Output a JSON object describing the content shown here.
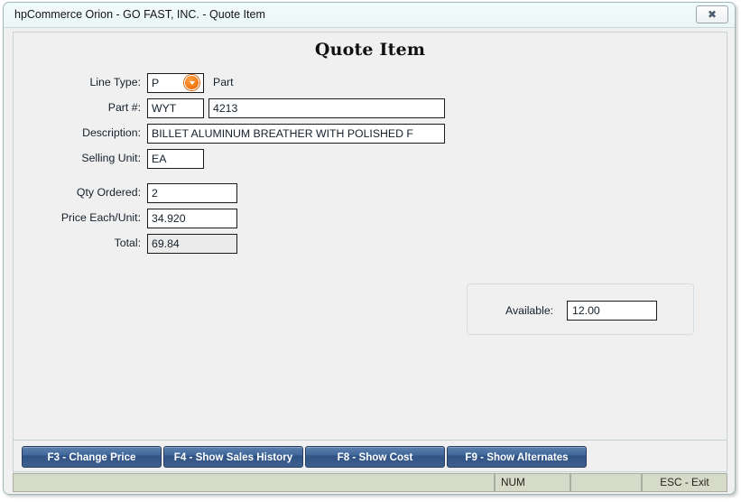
{
  "window": {
    "title": "hpCommerce Orion - GO FAST, INC. - Quote Item",
    "close_glyph": "✖"
  },
  "page": {
    "title": "Quote Item"
  },
  "form": {
    "line_type": {
      "label": "Line Type:",
      "value": "P",
      "suffix_text": "Part"
    },
    "part_number": {
      "label": "Part #:",
      "prefix_value": "WYT",
      "value": "4213"
    },
    "description": {
      "label": "Description:",
      "value": "BILLET ALUMINUM BREATHER WITH POLISHED F"
    },
    "selling_unit": {
      "label": "Selling Unit:",
      "value": "EA"
    },
    "qty_ordered": {
      "label": "Qty Ordered:",
      "value": "2"
    },
    "price_each_unit": {
      "label": "Price Each/Unit:",
      "value": "34.920"
    },
    "total": {
      "label": "Total:",
      "value": "69.84"
    }
  },
  "available_panel": {
    "label": "Available:",
    "value": "12.00"
  },
  "buttons": [
    {
      "label": "F3 - Change Price"
    },
    {
      "label": "F4 - Show Sales History"
    },
    {
      "label": "F8 - Show Cost"
    },
    {
      "label": "F9 - Show Alternates"
    }
  ],
  "statusbar": {
    "message": "",
    "num_indicator": "NUM",
    "spacer": "",
    "exit_hint": "ESC - Exit"
  },
  "colors": {
    "button_blue": "#3f679b",
    "dropdown_orange": "#f57c15",
    "statusbar_bg": "#d6dac8",
    "titlebar_bg": "#eaf6f6"
  }
}
